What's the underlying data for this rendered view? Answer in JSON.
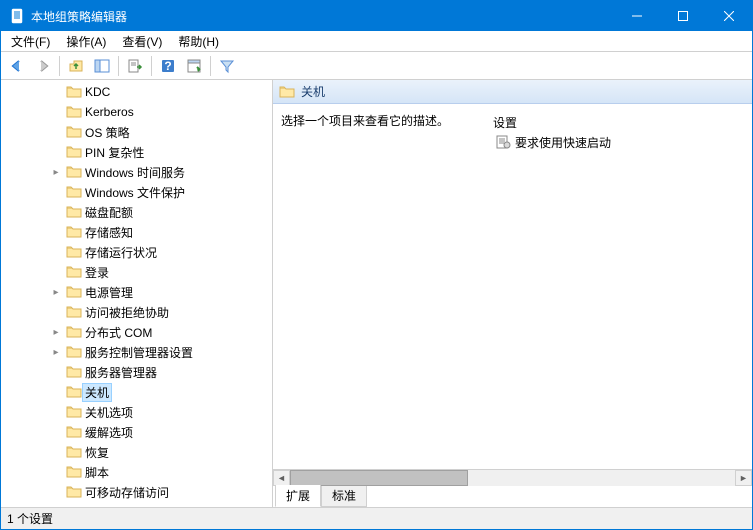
{
  "window": {
    "title": "本地组策略编辑器"
  },
  "menu": {
    "file": "文件(F)",
    "action": "操作(A)",
    "view": "查看(V)",
    "help": "帮助(H)"
  },
  "tree": {
    "items": [
      {
        "label": "KDC",
        "expand": ""
      },
      {
        "label": "Kerberos",
        "expand": ""
      },
      {
        "label": "OS 策略",
        "expand": ""
      },
      {
        "label": "PIN 复杂性",
        "expand": ""
      },
      {
        "label": "Windows 时间服务",
        "expand": ">"
      },
      {
        "label": "Windows 文件保护",
        "expand": ""
      },
      {
        "label": "磁盘配额",
        "expand": ""
      },
      {
        "label": "存储感知",
        "expand": ""
      },
      {
        "label": "存储运行状况",
        "expand": ""
      },
      {
        "label": "登录",
        "expand": ""
      },
      {
        "label": "电源管理",
        "expand": ">"
      },
      {
        "label": "访问被拒绝协助",
        "expand": ""
      },
      {
        "label": "分布式 COM",
        "expand": ">"
      },
      {
        "label": "服务控制管理器设置",
        "expand": ">"
      },
      {
        "label": "服务器管理器",
        "expand": ""
      },
      {
        "label": "关机",
        "expand": "",
        "selected": true
      },
      {
        "label": "关机选项",
        "expand": ""
      },
      {
        "label": "缓解选项",
        "expand": ""
      },
      {
        "label": "恢复",
        "expand": ""
      },
      {
        "label": "脚本",
        "expand": ""
      },
      {
        "label": "可移动存储访问",
        "expand": ""
      }
    ]
  },
  "detail": {
    "header": "关机",
    "desc": "选择一个项目来查看它的描述。",
    "column": "设置",
    "items": [
      {
        "label": "要求使用快速启动"
      }
    ]
  },
  "tabs": {
    "extended": "扩展",
    "standard": "标准"
  },
  "status": "1 个设置"
}
